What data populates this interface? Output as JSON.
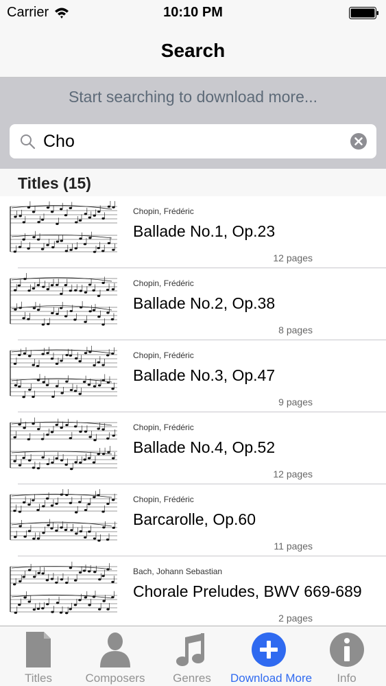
{
  "status_bar": {
    "carrier": "Carrier",
    "time": "10:10 PM"
  },
  "nav": {
    "title": "Search"
  },
  "search": {
    "hint": "Start searching to download more...",
    "value": "Cho"
  },
  "section": {
    "title": "Titles (15)"
  },
  "items": [
    {
      "composer": "Chopin, Frédéric",
      "title": "Ballade No.1, Op.23",
      "pages": "12 pages"
    },
    {
      "composer": "Chopin, Frédéric",
      "title": "Ballade No.2, Op.38",
      "pages": "8 pages"
    },
    {
      "composer": "Chopin, Frédéric",
      "title": "Ballade No.3, Op.47",
      "pages": "9 pages"
    },
    {
      "composer": "Chopin, Frédéric",
      "title": "Ballade No.4, Op.52",
      "pages": "12 pages"
    },
    {
      "composer": "Chopin, Frédéric",
      "title": "Barcarolle, Op.60",
      "pages": "11 pages"
    },
    {
      "composer": "Bach, Johann Sebastian",
      "title": "Chorale Preludes, BWV 669-689",
      "pages": "2 pages"
    }
  ],
  "tabs": [
    {
      "label": "Titles",
      "icon": "document-icon",
      "active": false
    },
    {
      "label": "Composers",
      "icon": "person-icon",
      "active": false
    },
    {
      "label": "Genres",
      "icon": "music-note-icon",
      "active": false
    },
    {
      "label": "Download More",
      "icon": "plus-circle-icon",
      "active": true
    },
    {
      "label": "Info",
      "icon": "info-icon",
      "active": false
    }
  ],
  "colors": {
    "accent": "#2f6af0",
    "tab_inactive": "#929292",
    "search_band": "#c9c9ce"
  }
}
